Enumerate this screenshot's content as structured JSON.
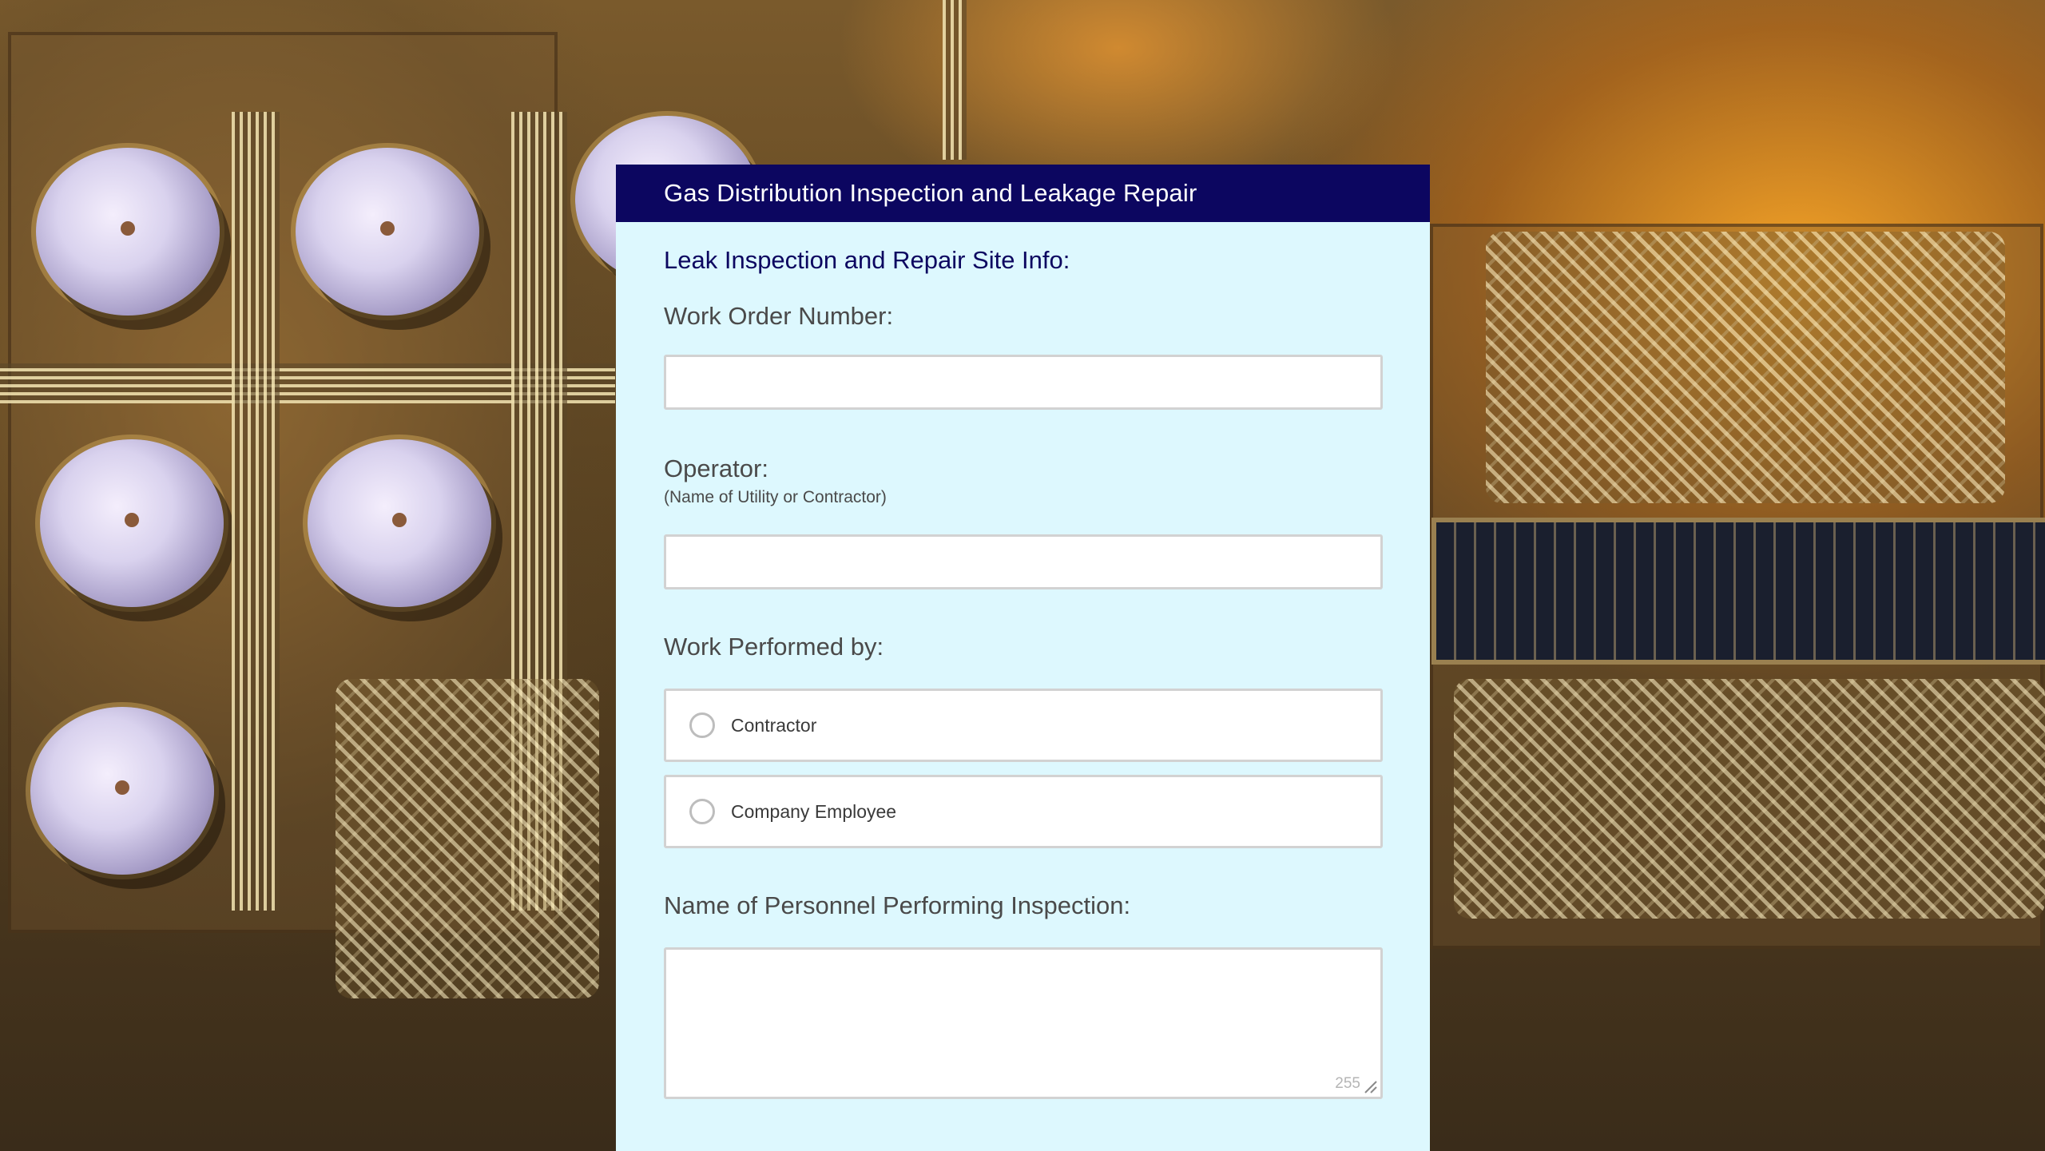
{
  "form": {
    "header_title": "Gas Distribution Inspection and Leakage Repair",
    "section_title": "Leak Inspection and Repair Site Info:",
    "work_order": {
      "label": "Work Order Number:",
      "value": ""
    },
    "operator": {
      "label": "Operator:",
      "sublabel": "(Name of Utility or Contractor)",
      "value": ""
    },
    "work_performed_by": {
      "label": "Work Performed by:",
      "options": [
        {
          "label": "Contractor",
          "selected": false
        },
        {
          "label": "Company Employee",
          "selected": false
        }
      ]
    },
    "personnel_name": {
      "label": "Name of Personnel Performing Inspection:",
      "value": "",
      "char_count": "255"
    }
  },
  "colors": {
    "header_bg": "#0c0660",
    "card_bg": "#ddf8fe",
    "section_title": "#0c0660",
    "label_text": "#4a4a4a",
    "input_border": "#d2d2d2"
  },
  "icons": {
    "radio": "radio-circle-icon",
    "resize": "resize-handle-icon"
  }
}
